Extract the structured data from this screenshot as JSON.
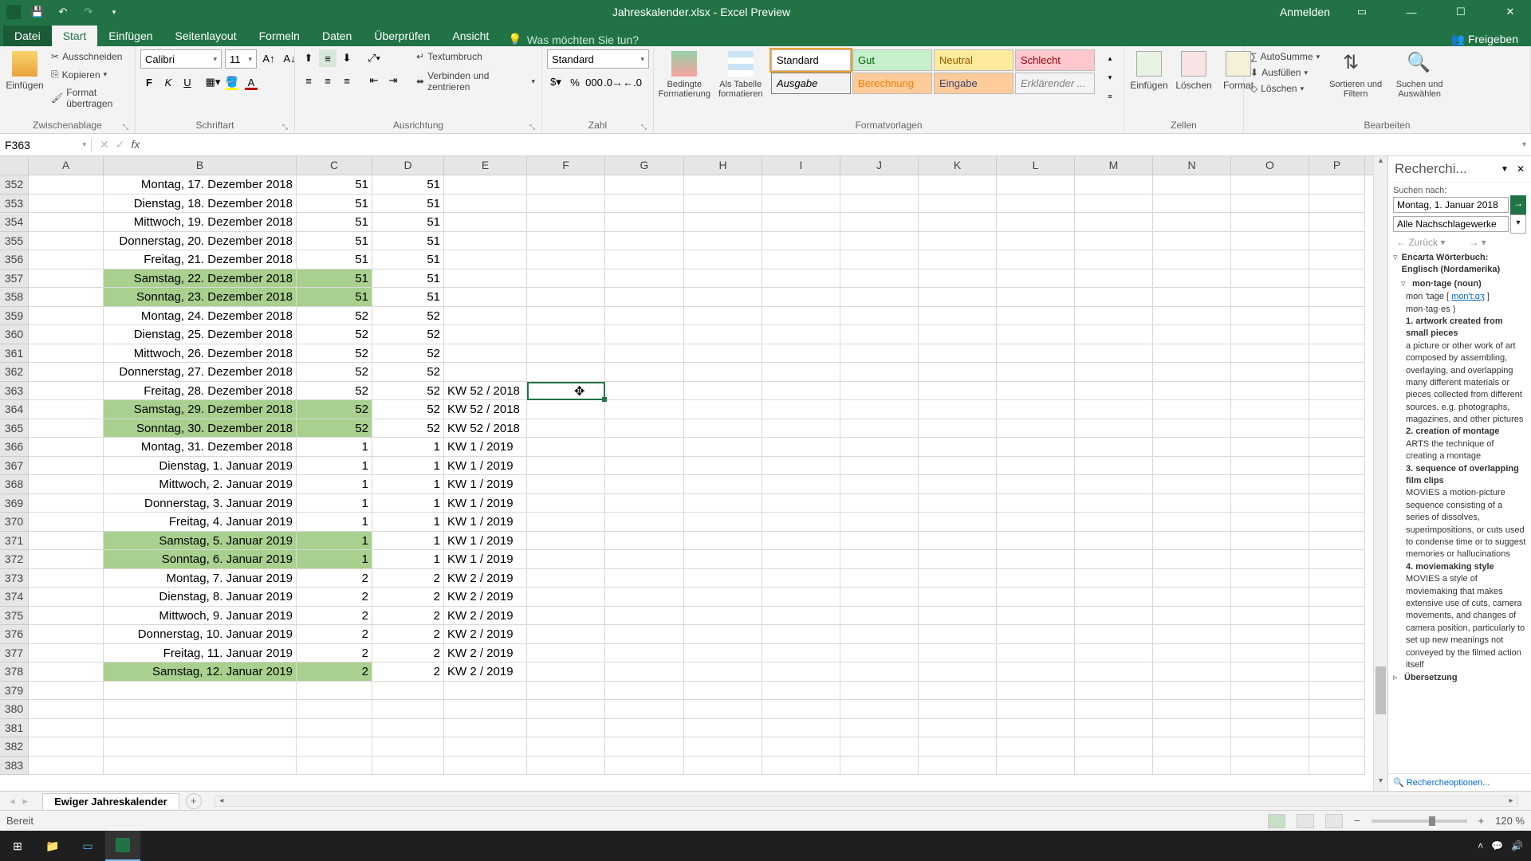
{
  "titlebar": {
    "doc_title": "Jahreskalender.xlsx - Excel Preview",
    "login": "Anmelden"
  },
  "tabs": {
    "file": "Datei",
    "items": [
      "Start",
      "Einfügen",
      "Seitenlayout",
      "Formeln",
      "Daten",
      "Überprüfen",
      "Ansicht"
    ],
    "active": "Start",
    "tell_me": "Was möchten Sie tun?",
    "share": "Freigeben"
  },
  "ribbon": {
    "clipboard": {
      "label": "Zwischenablage",
      "paste": "Einfügen",
      "cut": "Ausschneiden",
      "copy": "Kopieren",
      "format_painter": "Format übertragen"
    },
    "font": {
      "label": "Schriftart",
      "name": "Calibri",
      "size": "11"
    },
    "alignment": {
      "label": "Ausrichtung",
      "wrap": "Textumbruch",
      "merge": "Verbinden und zentrieren"
    },
    "number": {
      "label": "Zahl",
      "format": "Standard"
    },
    "styles": {
      "label": "Formatvorlagen",
      "cond": "Bedingte Formatierung",
      "table": "Als Tabelle formatieren",
      "cell": "Format",
      "items": [
        "Standard",
        "Gut",
        "Neutral",
        "Schlecht",
        "Ausgabe",
        "Berechnung",
        "Eingabe",
        "Erklärender ..."
      ]
    },
    "cells": {
      "label": "Zellen",
      "insert": "Einfügen",
      "delete": "Löschen",
      "format": "Format"
    },
    "editing": {
      "label": "Bearbeiten",
      "autosum": "AutoSumme",
      "fill": "Ausfüllen",
      "clear": "Löschen",
      "sort": "Sortieren und Filtern",
      "find": "Suchen und Auswählen"
    }
  },
  "formula_bar": {
    "name_box": "F363"
  },
  "columns": [
    "A",
    "B",
    "C",
    "D",
    "E",
    "F",
    "G",
    "H",
    "I",
    "J",
    "K",
    "L",
    "M",
    "N",
    "O",
    "P"
  ],
  "rows": [
    {
      "n": 352,
      "b": "Montag, 17. Dezember 2018",
      "c": "51",
      "d": "51",
      "e": "",
      "w": false
    },
    {
      "n": 353,
      "b": "Dienstag, 18. Dezember 2018",
      "c": "51",
      "d": "51",
      "e": "",
      "w": false
    },
    {
      "n": 354,
      "b": "Mittwoch, 19. Dezember 2018",
      "c": "51",
      "d": "51",
      "e": "",
      "w": false
    },
    {
      "n": 355,
      "b": "Donnerstag, 20. Dezember 2018",
      "c": "51",
      "d": "51",
      "e": "",
      "w": false
    },
    {
      "n": 356,
      "b": "Freitag, 21. Dezember 2018",
      "c": "51",
      "d": "51",
      "e": "",
      "w": false
    },
    {
      "n": 357,
      "b": "Samstag, 22. Dezember 2018",
      "c": "51",
      "d": "51",
      "e": "",
      "w": true
    },
    {
      "n": 358,
      "b": "Sonntag, 23. Dezember 2018",
      "c": "51",
      "d": "51",
      "e": "",
      "w": true
    },
    {
      "n": 359,
      "b": "Montag, 24. Dezember 2018",
      "c": "52",
      "d": "52",
      "e": "",
      "w": false
    },
    {
      "n": 360,
      "b": "Dienstag, 25. Dezember 2018",
      "c": "52",
      "d": "52",
      "e": "",
      "w": false
    },
    {
      "n": 361,
      "b": "Mittwoch, 26. Dezember 2018",
      "c": "52",
      "d": "52",
      "e": "",
      "w": false
    },
    {
      "n": 362,
      "b": "Donnerstag, 27. Dezember 2018",
      "c": "52",
      "d": "52",
      "e": "",
      "w": false
    },
    {
      "n": 363,
      "b": "Freitag, 28. Dezember 2018",
      "c": "52",
      "d": "52",
      "e": "KW 52 / 2018",
      "w": false,
      "sel": true
    },
    {
      "n": 364,
      "b": "Samstag, 29. Dezember 2018",
      "c": "52",
      "d": "52",
      "e": "KW 52 / 2018",
      "w": true
    },
    {
      "n": 365,
      "b": "Sonntag, 30. Dezember 2018",
      "c": "52",
      "d": "52",
      "e": "KW 52 / 2018",
      "w": true
    },
    {
      "n": 366,
      "b": "Montag, 31. Dezember 2018",
      "c": "1",
      "d": "1",
      "e": "KW 1 / 2019",
      "w": false
    },
    {
      "n": 367,
      "b": "Dienstag, 1. Januar 2019",
      "c": "1",
      "d": "1",
      "e": "KW 1 / 2019",
      "w": false
    },
    {
      "n": 368,
      "b": "Mittwoch, 2. Januar 2019",
      "c": "1",
      "d": "1",
      "e": "KW 1 / 2019",
      "w": false
    },
    {
      "n": 369,
      "b": "Donnerstag, 3. Januar 2019",
      "c": "1",
      "d": "1",
      "e": "KW 1 / 2019",
      "w": false
    },
    {
      "n": 370,
      "b": "Freitag, 4. Januar 2019",
      "c": "1",
      "d": "1",
      "e": "KW 1 / 2019",
      "w": false
    },
    {
      "n": 371,
      "b": "Samstag, 5. Januar 2019",
      "c": "1",
      "d": "1",
      "e": "KW 1 / 2019",
      "w": true
    },
    {
      "n": 372,
      "b": "Sonntag, 6. Januar 2019",
      "c": "1",
      "d": "1",
      "e": "KW 1 / 2019",
      "w": true
    },
    {
      "n": 373,
      "b": "Montag, 7. Januar 2019",
      "c": "2",
      "d": "2",
      "e": "KW 2 / 2019",
      "w": false
    },
    {
      "n": 374,
      "b": "Dienstag, 8. Januar 2019",
      "c": "2",
      "d": "2",
      "e": "KW 2 / 2019",
      "w": false
    },
    {
      "n": 375,
      "b": "Mittwoch, 9. Januar 2019",
      "c": "2",
      "d": "2",
      "e": "KW 2 / 2019",
      "w": false
    },
    {
      "n": 376,
      "b": "Donnerstag, 10. Januar 2019",
      "c": "2",
      "d": "2",
      "e": "KW 2 / 2019",
      "w": false
    },
    {
      "n": 377,
      "b": "Freitag, 11. Januar 2019",
      "c": "2",
      "d": "2",
      "e": "KW 2 / 2019",
      "w": false
    },
    {
      "n": 378,
      "b": "Samstag, 12. Januar 2019",
      "c": "2",
      "d": "2",
      "e": "KW 2 / 2019",
      "w": true
    },
    {
      "n": 379,
      "b": "",
      "c": "",
      "d": "",
      "e": "",
      "w": false
    },
    {
      "n": 380,
      "b": "",
      "c": "",
      "d": "",
      "e": "",
      "w": false
    },
    {
      "n": 381,
      "b": "",
      "c": "",
      "d": "",
      "e": "",
      "w": false
    },
    {
      "n": 382,
      "b": "",
      "c": "",
      "d": "",
      "e": "",
      "w": false
    },
    {
      "n": 383,
      "b": "",
      "c": "",
      "d": "",
      "e": "",
      "w": false
    }
  ],
  "research": {
    "title": "Recherchi...",
    "search_label": "Suchen nach:",
    "search_value": "Montag, 1. Januar 2018",
    "all_sources": "Alle Nachschlagewerke",
    "back": "Zurück",
    "source": "Encarta Wörterbuch: Englisch (Nordamerika)",
    "headword": "mon·tage (noun)",
    "pron1": "mon 'tage [ ",
    "pron_link": "mon't:ɑʒ",
    "pron2": " ]",
    "pron3": "mon·tag·es )",
    "sense1_head": "1. artwork created from small pieces",
    "sense1_body": "a picture or other work of art composed by assembling, overlaying, and overlapping many different materials or pieces collected from different sources, e.g. photographs, magazines, and other pictures",
    "sense2_head": "2. creation of montage",
    "sense2_body": "ARTS the technique of creating a montage",
    "sense3_head": "3. sequence of overlapping film clips",
    "sense3_body": "MOVIES a motion-picture sequence consisting of a series of dissolves, superimpositions, or cuts used to condense time or to suggest memories or hallucinations",
    "sense4_head": "4. moviemaking style",
    "sense4_body": "MOVIES a style of moviemaking that makes extensive use of cuts, camera movements, and changes of camera position, particularly to set up new meanings not conveyed by the filmed action itself",
    "translate": "Übersetzung",
    "options": "Rechercheoptionen..."
  },
  "sheet": {
    "name": "Ewiger Jahreskalender"
  },
  "status": {
    "ready": "Bereit",
    "zoom": "120 %"
  },
  "taskbar": {
    "time": "",
    "date": ""
  }
}
